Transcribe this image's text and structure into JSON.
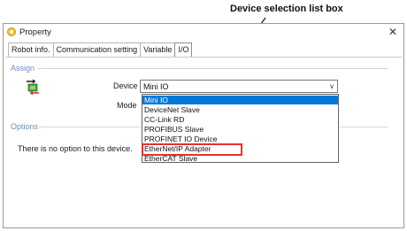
{
  "annotation": {
    "text": "Device selection list box"
  },
  "window": {
    "title": "Property",
    "close_glyph": "✕"
  },
  "tabs": [
    {
      "label": "Robot info."
    },
    {
      "label": "Communication setting"
    },
    {
      "label": "Variable"
    },
    {
      "label": "I/O"
    }
  ],
  "active_tab": "I/O",
  "assign": {
    "group_label": "Assign",
    "device_icon": "io-transfer-icon",
    "device_label": "Device",
    "mode_label": "Mode",
    "device_value": "Mini IO",
    "dropdown_arrow": "∨",
    "options": [
      "Mini IO",
      "DeviceNet Slave",
      "CC-Link RD",
      "PROFIBUS Slave",
      "PROFINET IO Device",
      "EtherNet/IP Adapter",
      "EtherCAT Slave"
    ],
    "selected_option": "Mini IO",
    "highlighted_option": "EtherNet/IP Adapter"
  },
  "options_group": {
    "group_label": "Options",
    "message": "There is no option to this device."
  },
  "colors": {
    "selection": "#0078d7",
    "highlight_box": "#e5322d",
    "group_label": "#6f8bc0"
  }
}
